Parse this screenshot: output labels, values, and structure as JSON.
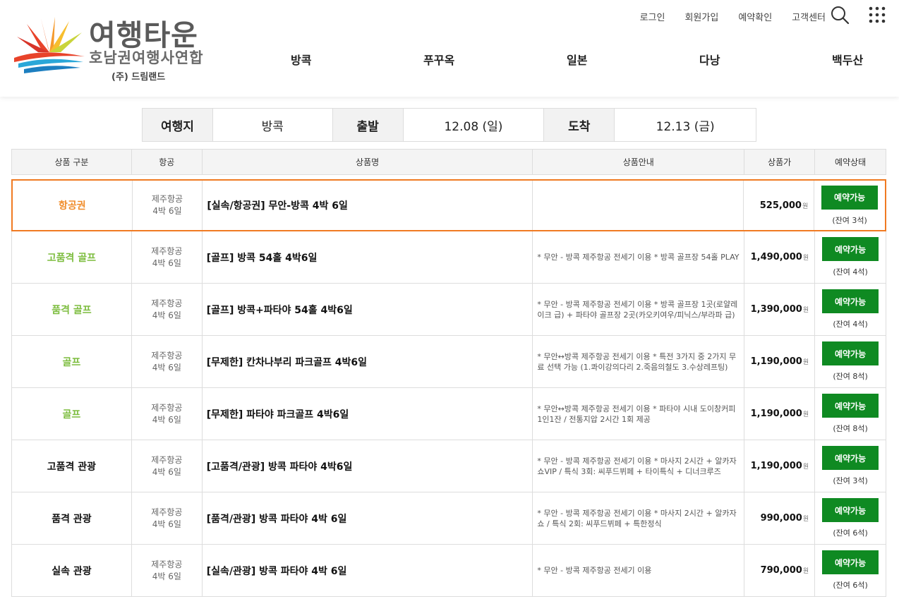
{
  "logo": {
    "title": "여행타운",
    "subtitle": "호남권여행사연합",
    "company": "(주) 드림랜드"
  },
  "util_menu": [
    "로그인",
    "회원가입",
    "예약확인",
    "고객센터"
  ],
  "icons": {
    "search": "search-icon",
    "menu": "grid-menu-icon"
  },
  "nav": [
    "방콕",
    "푸꾸옥",
    "일본",
    "다낭",
    "백두산"
  ],
  "summary": {
    "dest_label": "여행지",
    "dest": "방콕",
    "depart_label": "출발",
    "depart": "12.08 (일)",
    "arrive_label": "도착",
    "arrive": "12.13 (금)"
  },
  "table": {
    "headers": [
      "상품 구분",
      "항공",
      "상품명",
      "상품안내",
      "상품가",
      "예약상태"
    ],
    "price_unit": "원",
    "rows": [
      {
        "category": "항공권",
        "cat_color": "orange",
        "airline": "제주항공",
        "duration": "4박 6일",
        "name": "[실속/항공권] 무안-방콕 4박 6일",
        "desc": "",
        "price": "525,000",
        "status": "예약가능",
        "remain": "(잔여 3석)"
      },
      {
        "category": "고품격 골프",
        "cat_color": "green",
        "airline": "제주항공",
        "duration": "4박 6일",
        "name": "[골프] 방콕 54홀 4박6일",
        "desc": "* 무안 - 방콕 제주항공 전세기 이용 * 방콕 골프장 54홀 PLAY",
        "price": "1,490,000",
        "status": "예약가능",
        "remain": "(잔여 4석)"
      },
      {
        "category": "품격 골프",
        "cat_color": "green",
        "airline": "제주항공",
        "duration": "4박 6일",
        "name": "[골프] 방콕+파타야 54홀 4박6일",
        "desc": "* 무안 - 방콕 제주항공 전세기 이용 * 방콕 골프장 1곳(로얄레이크 급) + 파타야 골프장 2곳(카오키여우/피닉스/부라파 급)",
        "price": "1,390,000",
        "status": "예약가능",
        "remain": "(잔여 4석)"
      },
      {
        "category": "골프",
        "cat_color": "green",
        "airline": "제주항공",
        "duration": "4박 6일",
        "name": "[무제한] 칸차나부리 파크골프 4박6일",
        "desc": "* 무안↔방콕 제주항공 전세기 이용 * 특전 3가지 중 2가지 무료 선택 가능 (1.콰이강의다리 2.죽음의철도 3.수상레프팅)",
        "price": "1,190,000",
        "status": "예약가능",
        "remain": "(잔여 8석)"
      },
      {
        "category": "골프",
        "cat_color": "green",
        "airline": "제주항공",
        "duration": "4박 6일",
        "name": "[무제한] 파타야 파크골프 4박6일",
        "desc": "* 무안↔방콕 제주항공 전세기 이용 * 파타야 시내 도이창커피 1인1잔 / 전통지압 2시간 1회 제공",
        "price": "1,190,000",
        "status": "예약가능",
        "remain": "(잔여 8석)"
      },
      {
        "category": "고품격 관광",
        "cat_color": "black",
        "airline": "제주항공",
        "duration": "4박 6일",
        "name": "[고품격/관광] 방콕 파타야 4박6일",
        "desc": "* 무안 - 방콕 제주항공 전세기 이용 * 마사지 2시간 + 알카자쇼VIP / 특식 3회: 씨푸드뷔페 + 타이특식 + 디너크루즈",
        "price": "1,190,000",
        "status": "예약가능",
        "remain": "(잔여 3석)"
      },
      {
        "category": "품격 관광",
        "cat_color": "black",
        "airline": "제주항공",
        "duration": "4박 6일",
        "name": "[품격/관광] 방콕 파타야 4박 6일",
        "desc": "* 무안 - 방콕 제주항공 전세기 이용 * 마사지 2시간 + 알카자쇼 / 특식 2회: 씨푸드뷔페 + 특한정식",
        "price": "990,000",
        "status": "예약가능",
        "remain": "(잔여 6석)"
      },
      {
        "category": "실속 관광",
        "cat_color": "black",
        "airline": "제주항공",
        "duration": "4박 6일",
        "name": "[실속/관광] 방콕 파타야 4박 6일",
        "desc": "* 무안 - 방콕 제주항공 전세기 이용",
        "price": "790,000",
        "status": "예약가능",
        "remain": "(잔여 6석)"
      }
    ]
  }
}
